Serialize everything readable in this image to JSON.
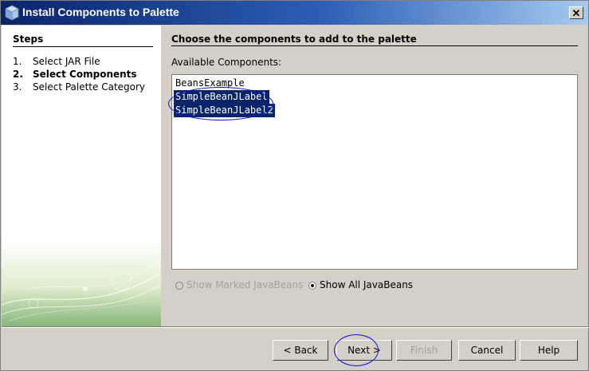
{
  "window": {
    "title": "Install Components to Palette"
  },
  "steps": {
    "title": "Steps",
    "items": [
      {
        "num": "1.",
        "label": "Select JAR File"
      },
      {
        "num": "2.",
        "label": "Select Components"
      },
      {
        "num": "3.",
        "label": "Select Palette Category"
      }
    ]
  },
  "main": {
    "title": "Choose the components to add to the palette",
    "available_label": "Available Components:",
    "components": [
      {
        "label": "BeansExample",
        "selected": false
      },
      {
        "label": "SimpleBeanJLabel",
        "selected": true
      },
      {
        "label": "SimpleBeanJLabel2",
        "selected": true
      }
    ],
    "radio_marked": {
      "label": "Show Marked JavaBeans",
      "checked": false,
      "enabled": false
    },
    "radio_all": {
      "label": "Show All JavaBeans",
      "checked": true,
      "enabled": true
    }
  },
  "buttons": {
    "back": "< Back",
    "next": "Next >",
    "finish": "Finish",
    "cancel": "Cancel",
    "help": "Help"
  },
  "colors": {
    "title_bar": "#0a246a",
    "selection": "#0a246a",
    "annotation": "#1010e0",
    "window_bg": "#d4d0c8"
  }
}
